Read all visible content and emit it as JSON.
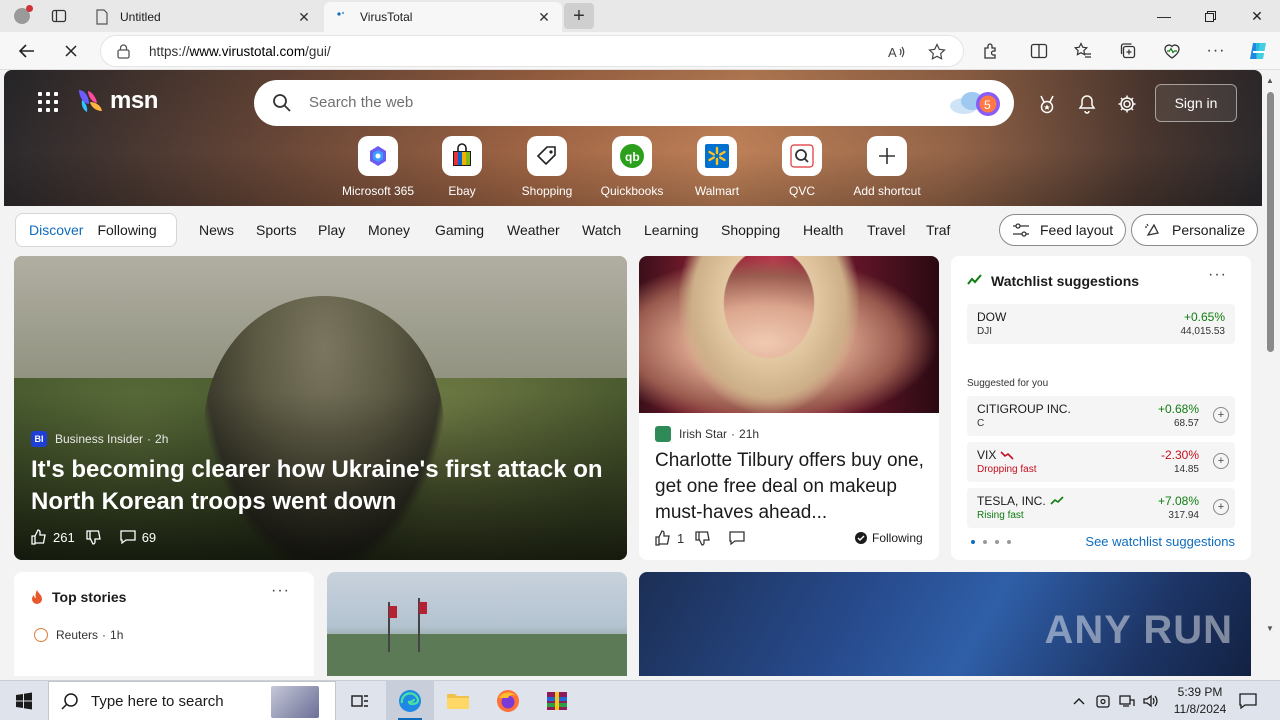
{
  "browser": {
    "tabs": [
      {
        "title": "Untitled",
        "active": false
      },
      {
        "title": "VirusTotal",
        "active": true
      }
    ],
    "url_prefix": "https://",
    "url_host": "www.virustotal.com",
    "url_path": "/gui/"
  },
  "msn": {
    "logo_text": "msn",
    "search_placeholder": "Search the web",
    "sign_in_label": "Sign in",
    "copilot_badge": "5",
    "shortcuts": [
      {
        "label": "Microsoft 365",
        "icon": "microsoft365-icon"
      },
      {
        "label": "Ebay",
        "icon": "ebay-icon"
      },
      {
        "label": "Shopping",
        "icon": "shopping-tag-icon"
      },
      {
        "label": "Quickbooks",
        "icon": "quickbooks-icon"
      },
      {
        "label": "Walmart",
        "icon": "walmart-icon"
      },
      {
        "label": "QVC",
        "icon": "qvc-icon"
      },
      {
        "label": "Add shortcut",
        "icon": "plus-icon"
      }
    ],
    "nav": {
      "pill": [
        "Discover",
        "Following"
      ],
      "items": [
        "News",
        "Sports",
        "Play",
        "Money",
        "Gaming",
        "Weather",
        "Watch",
        "Learning",
        "Shopping",
        "Health",
        "Travel",
        "Traf"
      ],
      "feed_layout_label": "Feed layout",
      "personalize_label": "Personalize"
    },
    "main_story": {
      "source": "Business Insider",
      "source_badge": "BI",
      "age": "2h",
      "headline": "It's becoming clearer how Ukraine's first attack on North Korean troops went down",
      "likes": "261",
      "comments": "69"
    },
    "second_story": {
      "source": "Irish Star",
      "age": "21h",
      "headline": "Charlotte Tilbury offers buy one, get one free deal on makeup must-haves ahead...",
      "likes": "1",
      "following_label": "Following"
    },
    "watchlist": {
      "title": "Watchlist suggestions",
      "top": {
        "name": "DOW",
        "symbol": "DJI",
        "change": "+0.65%",
        "value": "44,015.53"
      },
      "suggested_label": "Suggested for you",
      "items": [
        {
          "name": "CITIGROUP INC.",
          "symbol": "C",
          "change": "+0.68%",
          "value": "68.57",
          "trend": "up"
        },
        {
          "name": "VIX",
          "symbol": "Dropping fast",
          "change": "-2.30%",
          "value": "14.85",
          "trend": "down"
        },
        {
          "name": "TESLA, INC.",
          "symbol": "Rising fast",
          "change": "+7.08%",
          "value": "317.94",
          "trend": "up"
        }
      ],
      "see_more_label": "See watchlist suggestions"
    },
    "top_stories": {
      "title": "Top stories",
      "first_source": "Reuters",
      "first_age": "1h"
    },
    "watermark": "ANY RUN"
  },
  "taskbar": {
    "search_placeholder": "Type here to search",
    "time": "5:39 PM",
    "date": "11/8/2024"
  },
  "colors": {
    "accent": "#0f6cbd",
    "positive": "#107c10",
    "negative": "#c50f1f"
  }
}
